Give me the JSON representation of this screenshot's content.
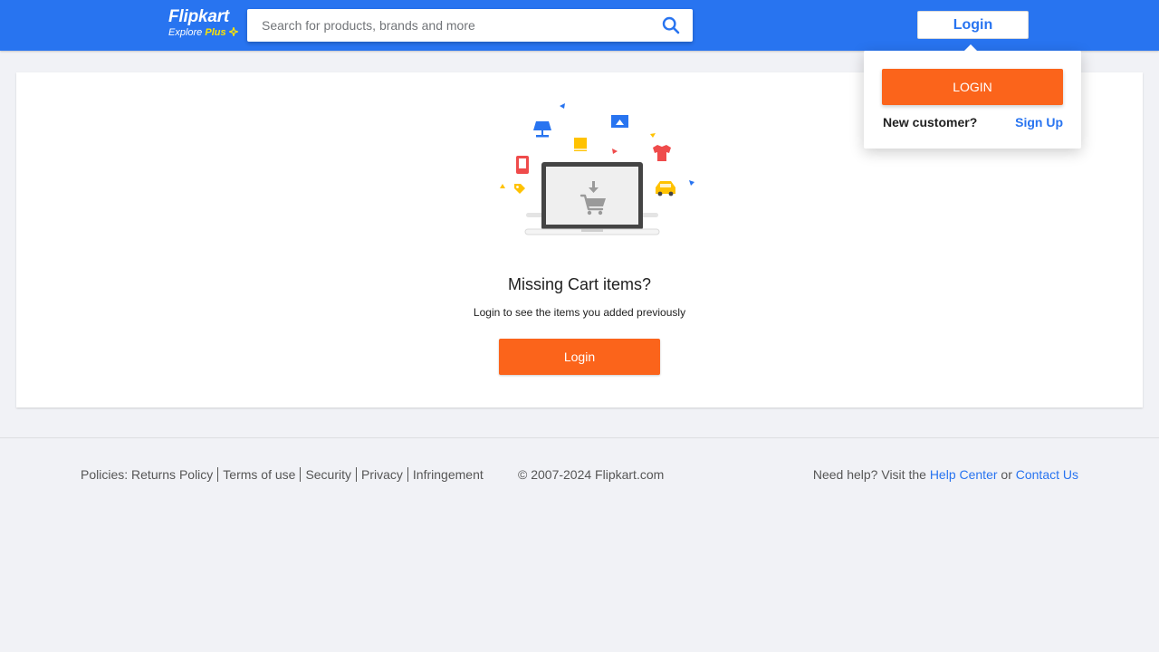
{
  "header": {
    "logo": {
      "name": "Flipkart",
      "tagline": "Explore",
      "plus": "Plus"
    },
    "search": {
      "placeholder": "Search for products, brands and more",
      "value": ""
    },
    "login_label": "Login"
  },
  "login_popup": {
    "login_button": "LOGIN",
    "new_customer": "New customer?",
    "signup": "Sign Up"
  },
  "empty_cart": {
    "title": "Missing Cart items?",
    "subtitle": "Login to see the items you added previously",
    "login_button": "Login"
  },
  "footer": {
    "policies_label": "Policies:",
    "policies": [
      "Returns Policy",
      "Terms of use",
      "Security",
      "Privacy",
      "Infringement"
    ],
    "copyright": "© 2007-2024 Flipkart.com",
    "help_text": "Need help? Visit the",
    "help_center": "Help Center",
    "or": "or",
    "contact_us": "Contact Us"
  },
  "colors": {
    "brand_blue": "#2874f0",
    "action_orange": "#fb641b",
    "plus_yellow": "#ffe500",
    "page_background": "#f1f2f6"
  },
  "icons": {
    "search": "search-icon",
    "plus": "plus-icon",
    "illustration": "empty-cart-illustration"
  }
}
